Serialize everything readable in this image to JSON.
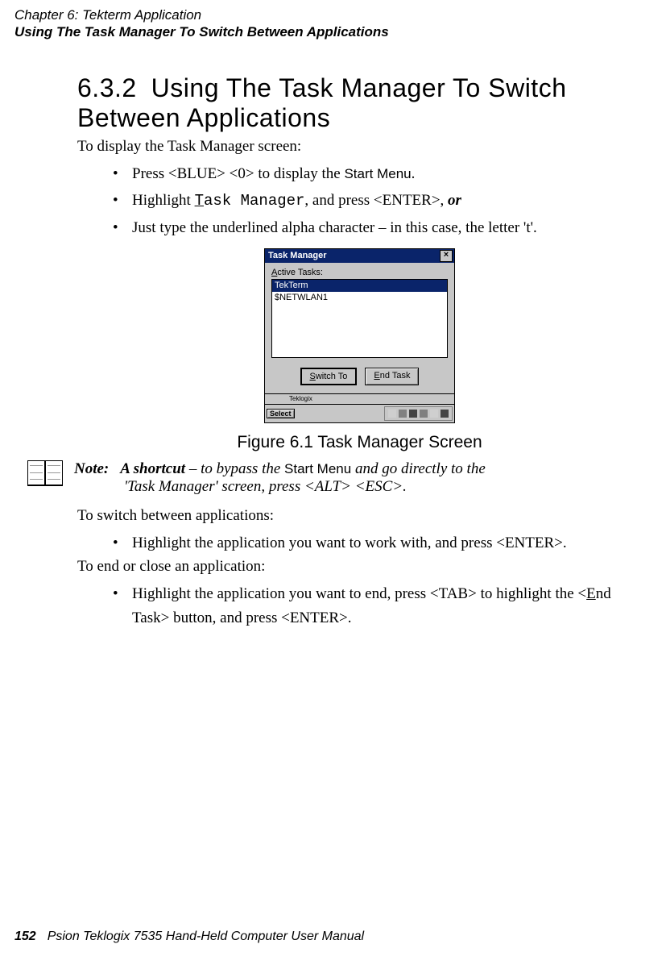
{
  "header": {
    "chapter_line": "Chapter 6: Tekterm Application",
    "section_line": "Using The Task Manager To Switch Between Applications"
  },
  "heading": {
    "number": "6.3.2",
    "title": "Using The Task Manager To Switch Between Applications"
  },
  "intro": "To display the Task Manager screen:",
  "bullets1": {
    "b1_a": "Press <BLUE> <0> to display the ",
    "b1_sf": "Start Menu",
    "b1_c": ".",
    "b2_a": "Highlight ",
    "b2_mono_u": "T",
    "b2_mono_rest": "ask Manager",
    "b2_c": ",  and press <ENTER>, ",
    "b2_or": "or",
    "b3": "Just type the underlined alpha character – in this case, the letter 't'."
  },
  "screenshot": {
    "title": "Task Manager",
    "close": "×",
    "active_label_a": "A",
    "active_label_rest": "ctive Tasks:",
    "items": [
      "TekTerm",
      "$NETWLAN1"
    ],
    "switch_u": "S",
    "switch_rest": "witch To",
    "end_u": "E",
    "end_rest": "nd Task",
    "teklogix": "Teklogix",
    "select": "Select"
  },
  "caption": "Figure 6.1 Task Manager Screen",
  "note": {
    "label": "Note:",
    "l1_a": "A shortcut",
    "l1_b": " – to bypass the ",
    "l1_sf": "Start Menu",
    "l1_c": " and go directly to the",
    "l2": "'Task Manager' screen, press <ALT> <ESC>."
  },
  "switch_intro": "To switch between applications:",
  "switch_bullet": "Highlight the application you want to work with, and press <ENTER>.",
  "end_intro": "To end or close an application:",
  "end_bullet_a": "Highlight the application you want to end, press <TAB> to highlight the <",
  "end_bullet_u": "E",
  "end_bullet_b": "nd Task> button, and press <ENTER>.",
  "footer": {
    "page": "152",
    "text": "Psion Teklogix 7535 Hand-Held Computer User Manual"
  }
}
